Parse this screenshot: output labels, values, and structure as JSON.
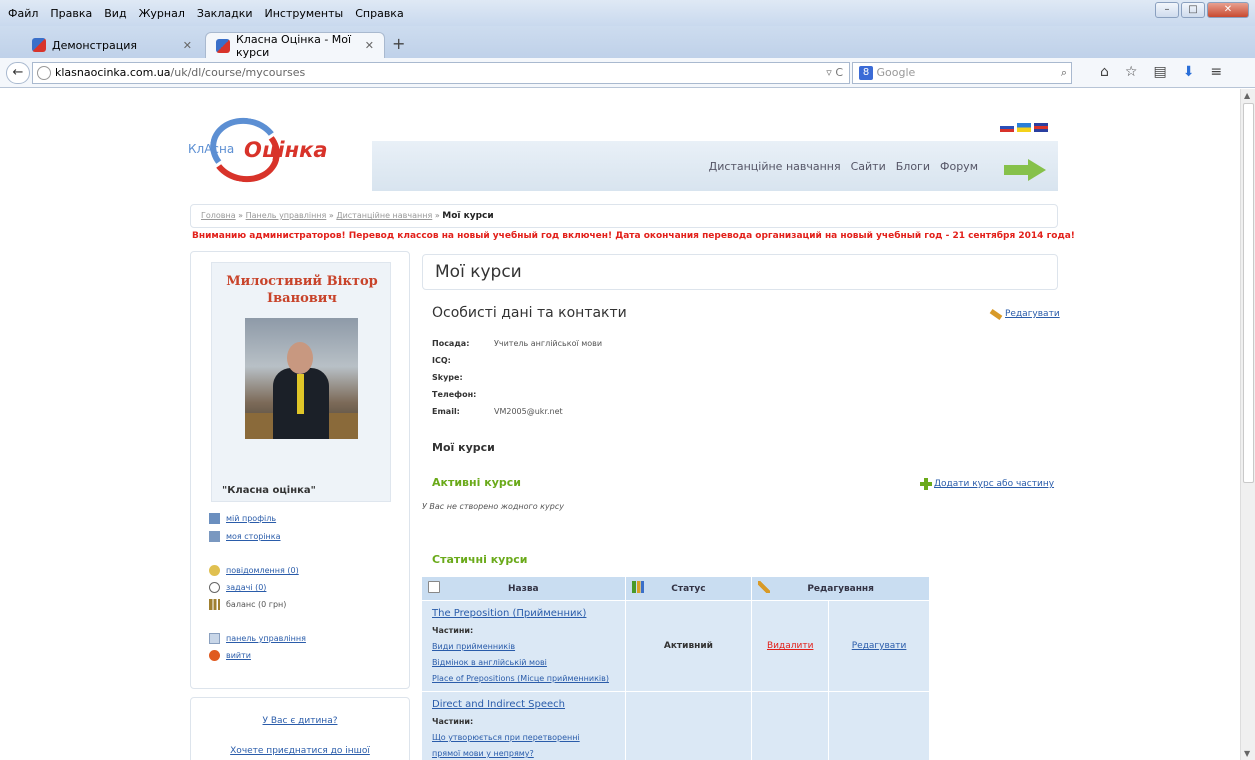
{
  "browser": {
    "menu": [
      "Файл",
      "Правка",
      "Вид",
      "Журнал",
      "Закладки",
      "Инструменты",
      "Справка"
    ],
    "tabs": [
      {
        "label": "Демонстрация"
      },
      {
        "label": "Класна Оцінка - Мої курси"
      }
    ],
    "url_domain": "klasnaocinka.com.ua",
    "url_path": "/uk/dl/course/mycourses",
    "search_placeholder": "Google"
  },
  "site": {
    "logo_small": "КлАсна",
    "logo_big": "Оцінка",
    "nav": [
      "Дистанційне навчання",
      "Сайти",
      "Блоги",
      "Форум"
    ]
  },
  "breadcrumb": {
    "items": [
      "Головна",
      "Панель управління",
      "Дистанційне навчання"
    ],
    "current": "Мої курси"
  },
  "alert": "Вниманию администраторов! Перевод классов на новый учебный год включен! Дата окончания перевода организаций на новый учебный год - 21 сентября 2014 года!",
  "profile": {
    "name": "Милостивий Віктор Іванович",
    "school": "\"Класна оцінка\"",
    "links": [
      {
        "label": "мій профіль"
      },
      {
        "label": "моя сторінка"
      },
      {
        "label": "повідомлення (0)"
      },
      {
        "label": "задачі (0)"
      },
      {
        "label": "баланс (0 грн)"
      },
      {
        "label": "панель управління"
      },
      {
        "label": "вийти"
      }
    ],
    "extra_links": [
      "У Вас є дитина?",
      "Хочете приєднатися до іншої"
    ]
  },
  "main": {
    "title": "Мої курси",
    "personal_heading": "Особисті дані та контакти",
    "edit_label": "Редагувати",
    "fields": [
      {
        "key": "Посада:",
        "value": "Учитель англійської мови"
      },
      {
        "key": "ICQ:",
        "value": ""
      },
      {
        "key": "Skype:",
        "value": ""
      },
      {
        "key": "Телефон:",
        "value": ""
      },
      {
        "key": "Email:",
        "value": "VM2005@ukr.net"
      }
    ],
    "courses_heading": "Мої курси",
    "active_heading": "Активні курси",
    "add_course_label": "Додати курс або частину",
    "no_courses": "У Вас не створено жодного курсу",
    "static_heading": "Статичні курси",
    "table": {
      "headers": [
        "Назва",
        "Статус",
        "Редагування"
      ],
      "parts_label": "Частини:",
      "rows": [
        {
          "title": "The Preposition (Прийменник)",
          "parts": [
            "Види прийменників",
            "Відмінок в англійській мові",
            "Place of Prepositions (Місце прийменників)"
          ],
          "status": "Активний",
          "delete": "Видалити",
          "edit": "Редагувати"
        },
        {
          "title": "Direct and Indirect Speech",
          "parts": [
            "Що утворюється при перетворенні",
            "прямої мови у непряму?"
          ],
          "status": "",
          "delete": "",
          "edit": ""
        }
      ]
    }
  }
}
